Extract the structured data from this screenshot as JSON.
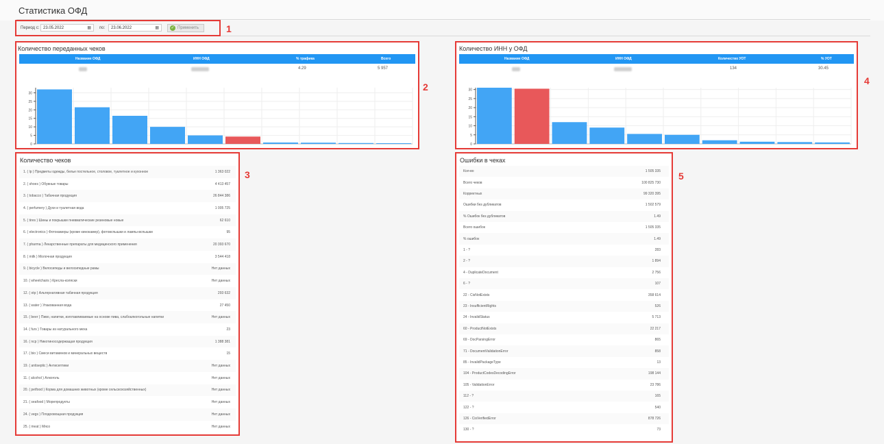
{
  "page": {
    "title": "Статистика ОФД"
  },
  "filter": {
    "period_from_label": "Период с:",
    "date_from": "23.05.2022",
    "period_to_label": "по:",
    "date_to": "23.06.2022",
    "apply_label": "Применить"
  },
  "annotations": [
    "1",
    "2",
    "3",
    "4",
    "5"
  ],
  "receipts_panel": {
    "title": "Количество переданных чеков",
    "headers": [
      "Название ОФД",
      "ИНН ОФД",
      "% трафика",
      "Всего"
    ],
    "row": {
      "traffic": "4.29",
      "total": "5 957"
    }
  },
  "inn_panel": {
    "title": "Количество ИНН у ОФД",
    "headers": [
      "Название ОФД",
      "ИНН ОФД",
      "Количество УОТ",
      "% УОТ"
    ],
    "row": {
      "count": "134",
      "percent": "30.45"
    }
  },
  "checks_panel": {
    "title": "Количество чеков",
    "rows": [
      {
        "label": "1. ( lp ) Предметы одежды, белье постельное, столовое, туалетное и кухонное",
        "value": "1 363 022"
      },
      {
        "label": "2. ( shoes ) Обувные товары",
        "value": "4 413 457"
      },
      {
        "label": "3. ( tobacco ) Табачная продукция",
        "value": "26 844 386"
      },
      {
        "label": "4. ( perfumery ) Духи и туалетная вода",
        "value": "1 005 725"
      },
      {
        "label": "5. ( tires ) Шины и покрышки пневматические резиновые новые",
        "value": "62 610"
      },
      {
        "label": "6. ( electronics ) Фотокамеры (кроме кинокамер), фотовспышки и лампы-вспышки",
        "value": "95"
      },
      {
        "label": "7. ( pharma ) Лекарственные препараты для медицинского применения",
        "value": "20 393 670"
      },
      {
        "label": "8. ( milk ) Молочная продукция",
        "value": "3 544 418"
      },
      {
        "label": "9. ( bicycle ) Велосипеды и велосипедные рамы",
        "value": "Нет данных"
      },
      {
        "label": "10. ( wheelchairs ) Кресла-коляски",
        "value": "Нет данных"
      },
      {
        "label": "12. ( otp ) Альтернативная табачная продукция",
        "value": "293 632"
      },
      {
        "label": "13. ( water ) Упакованная вода",
        "value": "27 450"
      },
      {
        "label": "15. ( beer ) Пиво, напитки, изготавливаемые на основе пива, слабоалкогольные напитки",
        "value": "Нет данных"
      },
      {
        "label": "14. ( furs ) Товары из натурального меха",
        "value": "23"
      },
      {
        "label": "16. ( ncp ) Никотиносодержащая продукция",
        "value": "1 388 381"
      },
      {
        "label": "17. ( bio ) Смеси витаминов и минеральных веществ",
        "value": "15"
      },
      {
        "label": "19. ( antiseptic ) Антисептики",
        "value": "Нет данных"
      },
      {
        "label": "11. ( alcohol ) Алкоголь",
        "value": "Нет данных"
      },
      {
        "label": "20. ( petfood ) Корма для домашних животных (кроме сельскохозяйственных)",
        "value": "Нет данных"
      },
      {
        "label": "21. ( seafood ) Морепродукты",
        "value": "Нет данных"
      },
      {
        "label": "24. ( vegs ) Плодоовощная продукция",
        "value": "Нет данных"
      },
      {
        "label": "25. ( meat ) Мясо",
        "value": "Нет данных"
      }
    ]
  },
  "errors_panel": {
    "title": "Ошибки в чеках",
    "rows": [
      {
        "label": "Кол-во",
        "value": "1 505 335"
      },
      {
        "label": "Всего чеков",
        "value": "100 825 730"
      },
      {
        "label": "Корректных",
        "value": "99 320 395"
      },
      {
        "label": "Ошибки без дубликатов",
        "value": "1 502 579"
      },
      {
        "label": "% Ошибок без дубликатов",
        "value": "1.49"
      },
      {
        "label": "Всего ошибок",
        "value": "1 505 335"
      },
      {
        "label": "% ошибок",
        "value": "1.49"
      },
      {
        "label": "1 - ?",
        "value": "283"
      },
      {
        "label": "2 - ?",
        "value": "1 894"
      },
      {
        "label": "4 - DuplicateDocument",
        "value": "2 756"
      },
      {
        "label": "6 - ?",
        "value": "107"
      },
      {
        "label": "22 - CisNotExists",
        "value": "358 614"
      },
      {
        "label": "23 - InsufficientRights",
        "value": "526"
      },
      {
        "label": "24 - InvalidStatus",
        "value": "5 713"
      },
      {
        "label": "60 - ProductNotExists",
        "value": "22 217"
      },
      {
        "label": "69 - DocParsingError",
        "value": "865"
      },
      {
        "label": "71 - DocumentValidationError",
        "value": "858"
      },
      {
        "label": "85 - InvalidPackageType",
        "value": "13"
      },
      {
        "label": "104 - ProductCodesDecodingError",
        "value": "198 144"
      },
      {
        "label": "105 - ValidationError",
        "value": "23 786"
      },
      {
        "label": "112 - ?",
        "value": "165"
      },
      {
        "label": "122 - ?",
        "value": "540"
      },
      {
        "label": "126 - CisVerifiedError",
        "value": "878 726"
      },
      {
        "label": "130 - ?",
        "value": "73"
      }
    ]
  },
  "chart_data": [
    {
      "type": "bar",
      "yticks": [
        "0",
        "5",
        "10",
        "15",
        "20",
        "25",
        "30"
      ],
      "ylim": [
        0,
        33
      ],
      "grid": true,
      "highlight_color": "#e8585a",
      "bar_color": "#42a5f5",
      "values": [
        32,
        21.5,
        16.5,
        10,
        5,
        4.3,
        0.8,
        0.7,
        0.5,
        0.4
      ],
      "highlight_index": 5
    },
    {
      "type": "bar",
      "yticks": [
        "0",
        "5",
        "10",
        "15",
        "20",
        "25",
        "30"
      ],
      "ylim": [
        0,
        31
      ],
      "grid": true,
      "highlight_color": "#e8585a",
      "bar_color": "#42a5f5",
      "values": [
        31,
        30.45,
        12,
        9,
        5.5,
        5,
        2,
        1.2,
        1,
        0.8
      ],
      "highlight_index": 1
    }
  ]
}
